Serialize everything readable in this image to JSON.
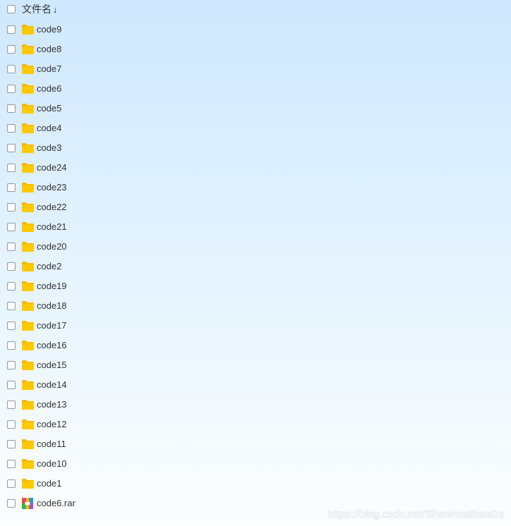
{
  "header": {
    "column_label": "文件名",
    "sort_indicator": "↓"
  },
  "rows": [
    {
      "name": "code9",
      "type": "folder"
    },
    {
      "name": "code8",
      "type": "folder"
    },
    {
      "name": "code7",
      "type": "folder"
    },
    {
      "name": "code6",
      "type": "folder"
    },
    {
      "name": "code5",
      "type": "folder"
    },
    {
      "name": "code4",
      "type": "folder"
    },
    {
      "name": "code3",
      "type": "folder"
    },
    {
      "name": "code24",
      "type": "folder"
    },
    {
      "name": "code23",
      "type": "folder"
    },
    {
      "name": "code22",
      "type": "folder"
    },
    {
      "name": "code21",
      "type": "folder"
    },
    {
      "name": "code20",
      "type": "folder"
    },
    {
      "name": "code2",
      "type": "folder"
    },
    {
      "name": "code19",
      "type": "folder"
    },
    {
      "name": "code18",
      "type": "folder"
    },
    {
      "name": "code17",
      "type": "folder"
    },
    {
      "name": "code16",
      "type": "folder"
    },
    {
      "name": "code15",
      "type": "folder"
    },
    {
      "name": "code14",
      "type": "folder"
    },
    {
      "name": "code13",
      "type": "folder"
    },
    {
      "name": "code12",
      "type": "folder"
    },
    {
      "name": "code11",
      "type": "folder"
    },
    {
      "name": "code10",
      "type": "folder"
    },
    {
      "name": "code1",
      "type": "folder"
    },
    {
      "name": "code6.rar",
      "type": "rar"
    }
  ],
  "icons": {
    "folder": "folder-icon",
    "rar": "rar-archive-icon"
  },
  "colors": {
    "folder": "#ffc900",
    "folder_tab": "#f4b800"
  },
  "watermark": "https://blog.csdn.net/ShaoHuaBiaoGe"
}
